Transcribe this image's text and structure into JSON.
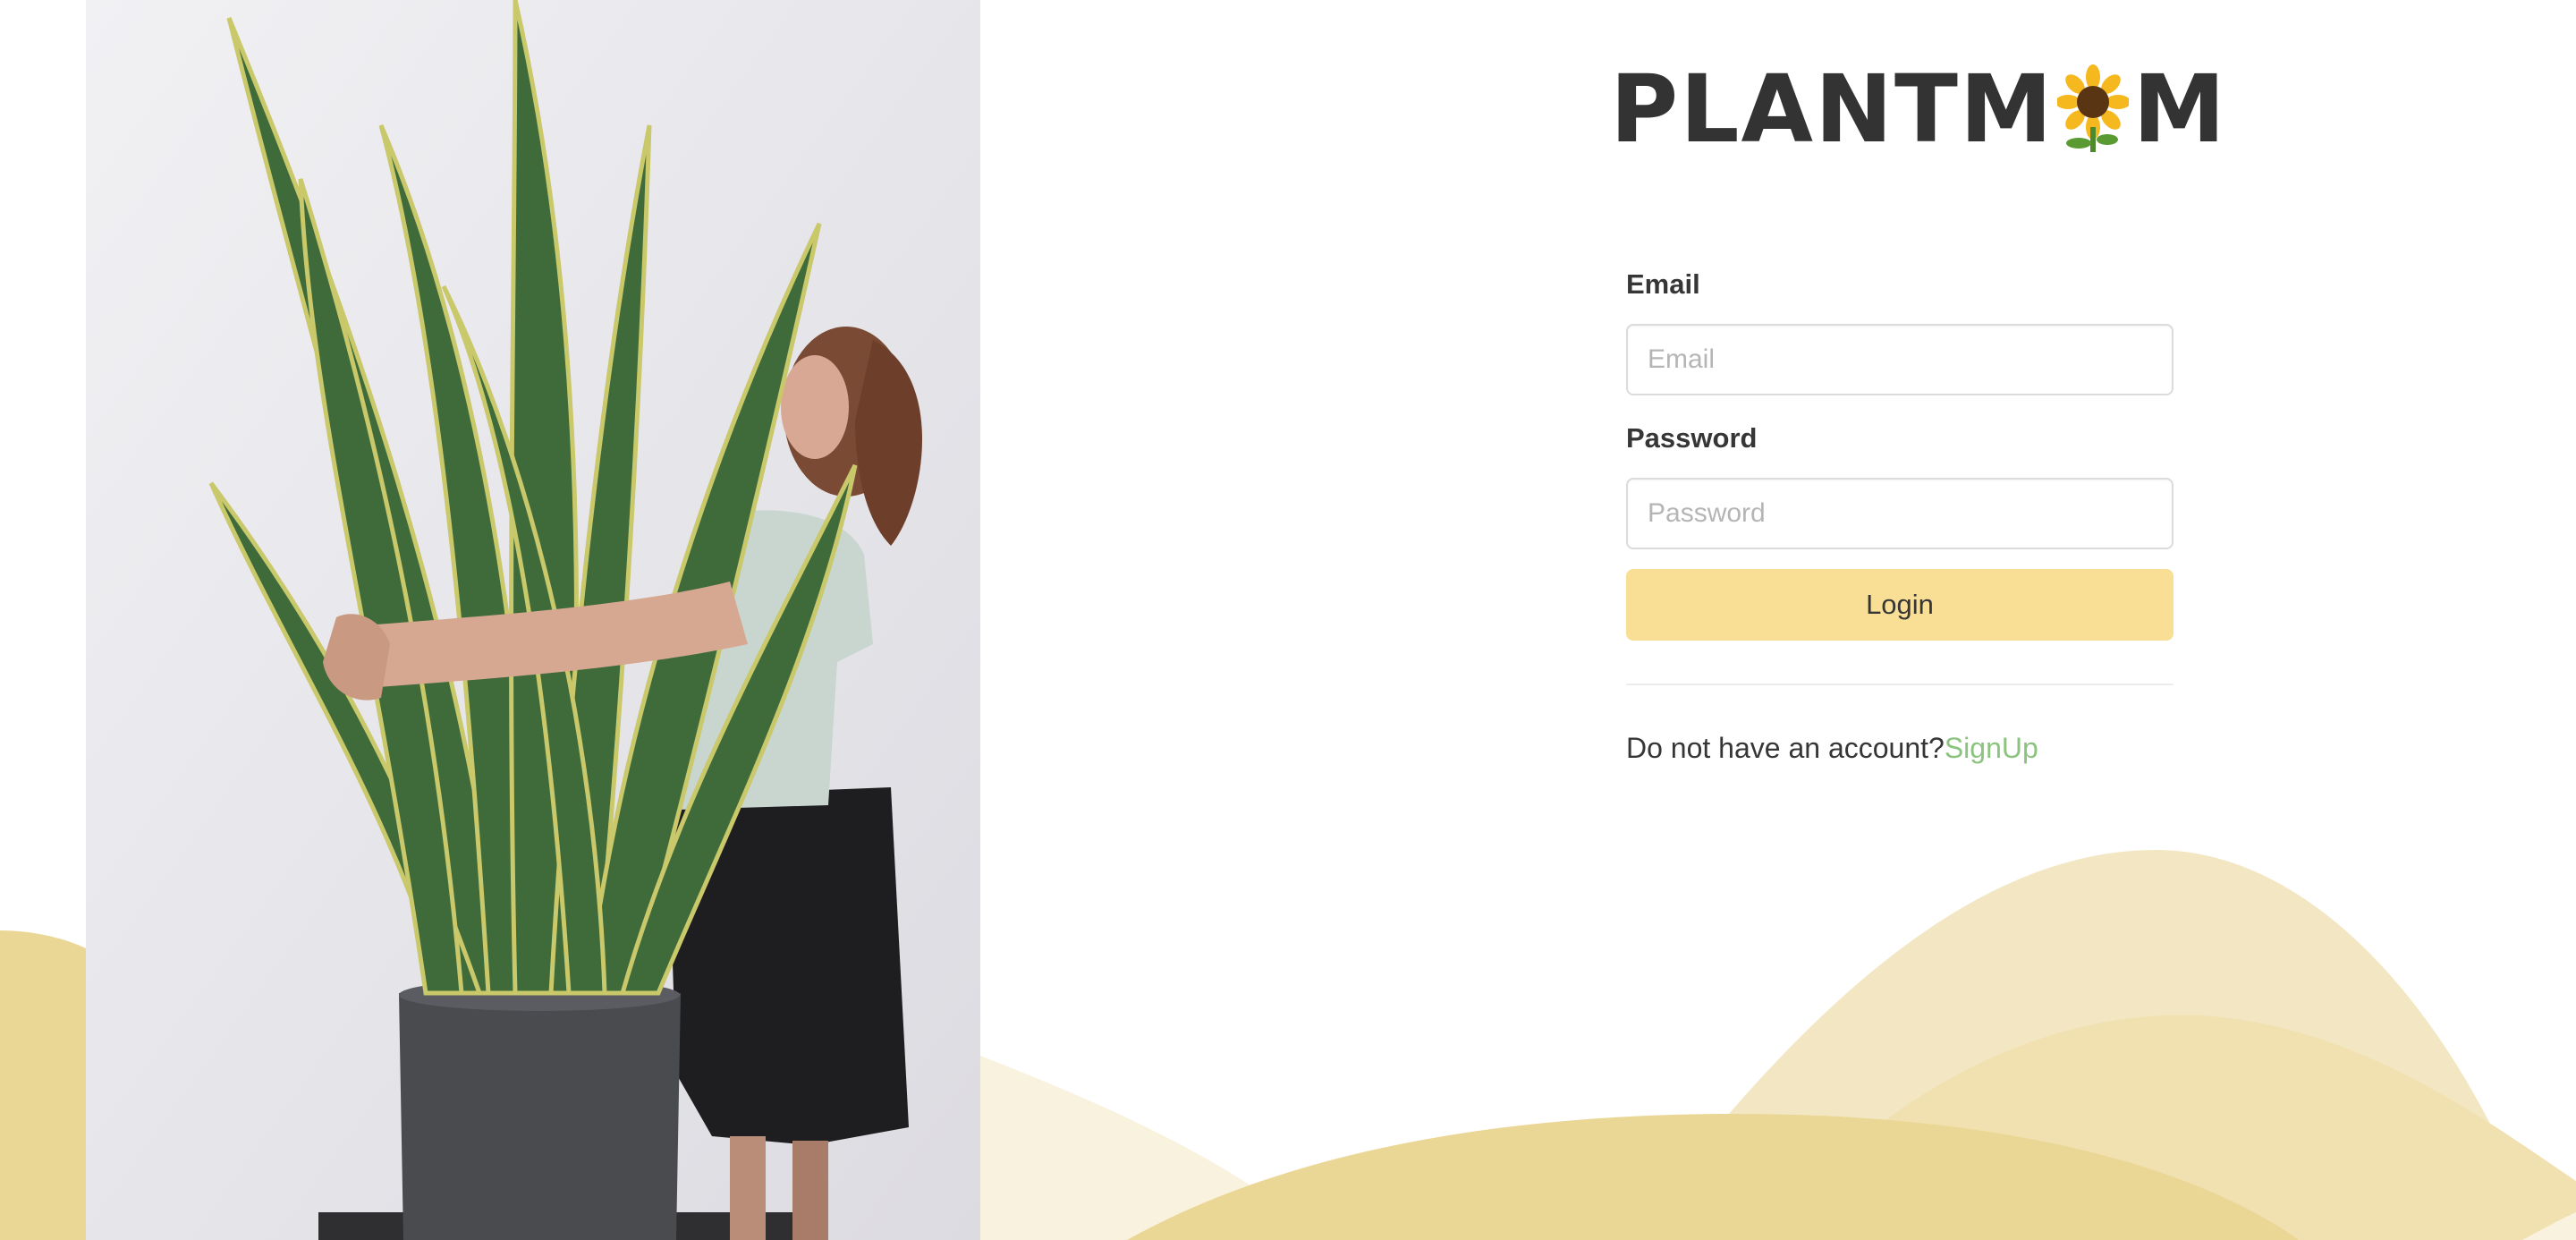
{
  "brand": {
    "logo_prefix": "PLANTM",
    "logo_suffix": "M",
    "logo_icon": "sunflower-icon"
  },
  "hero": {
    "image": "woman-hugging-snake-plant-photo"
  },
  "login_form": {
    "email_label": "Email",
    "email_placeholder": "Email",
    "email_value": "",
    "password_label": "Password",
    "password_placeholder": "Password",
    "password_value": "",
    "login_button_label": "Login",
    "signup_prompt": "Do not have an account?",
    "signup_link_label": "SignUp"
  },
  "colors": {
    "button_background": "#f9df95",
    "signup_link": "#8cc37f",
    "wave_dark": "#ead795",
    "wave_medium": "#f3e7c3",
    "wave_light": "#f9f2df",
    "text": "#363636"
  }
}
